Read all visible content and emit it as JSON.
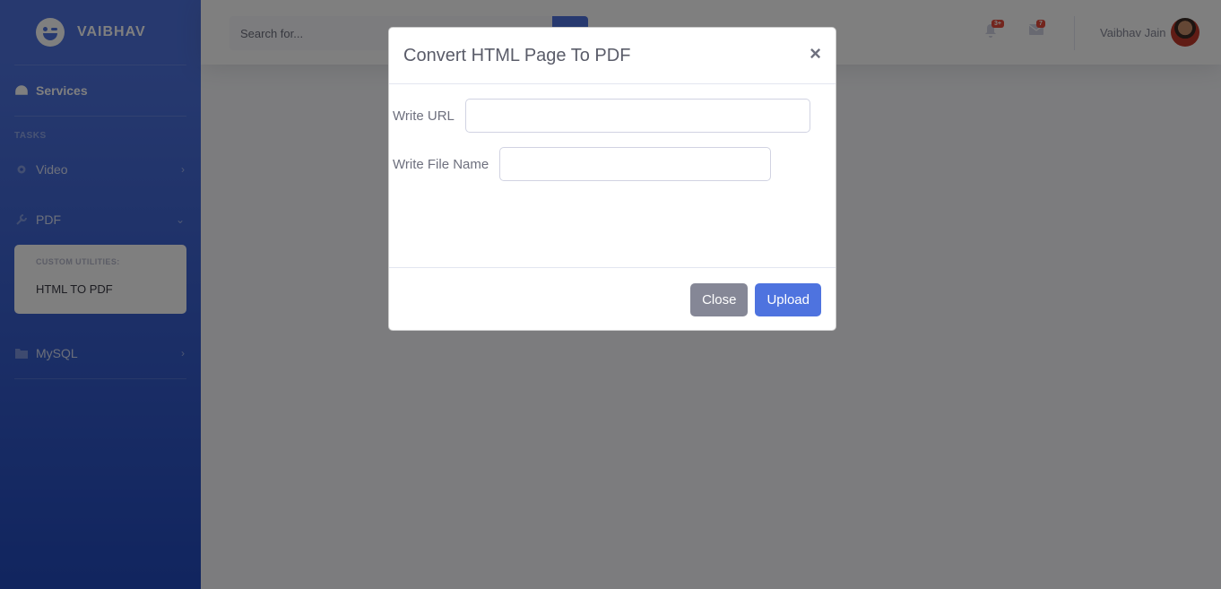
{
  "brand": {
    "name": "VAIBHAV"
  },
  "sidebar": {
    "dashboard_label": "Services",
    "heading": "TASKS",
    "items": [
      {
        "label": "Video",
        "icon": "cog-icon",
        "chevron": "›"
      },
      {
        "label": "PDF",
        "icon": "wrench-icon",
        "chevron": "⌄"
      },
      {
        "label": "MySQL",
        "icon": "folder-icon",
        "chevron": "›"
      }
    ],
    "collapse": {
      "header": "CUSTOM UTILITIES:",
      "items": [
        "HTML TO PDF"
      ]
    }
  },
  "topbar": {
    "search_placeholder": "Search for...",
    "alerts_badge": "3+",
    "messages_badge": "7",
    "user_name": "Vaibhav Jain"
  },
  "modal": {
    "title": "Convert HTML Page To PDF",
    "close_symbol": "×",
    "url_label": "Write URL",
    "url_value": "",
    "filename_label": "Write File Name",
    "filename_value": "",
    "close_button": "Close",
    "upload_button": "Upload"
  },
  "colors": {
    "primary": "#4e73df",
    "secondary": "#858796",
    "danger": "#e74a3b"
  }
}
